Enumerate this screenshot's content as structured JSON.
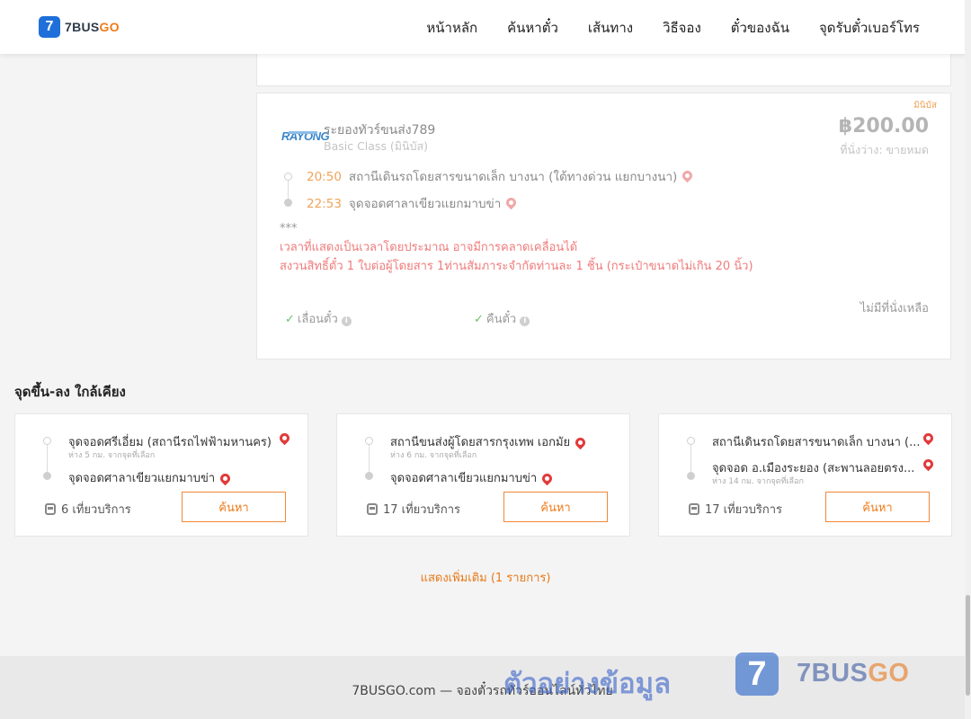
{
  "header": {
    "logo_mark": "7",
    "logo_text_main": "7BUS",
    "logo_text_accent": "GO",
    "nav": [
      "หน้าหลัก",
      "ค้นหาตั๋ว",
      "เส้นทาง",
      "วิธีจอง",
      "ตั๋วของฉัน",
      "จุดรับตั๋วเบอร์โทร"
    ]
  },
  "trip": {
    "badge": "มินิบัส",
    "operator_logo": "RAYONG",
    "operator_name": "ระยองทัวร์ขนส่ง789",
    "bus_class": "Basic Class (มินิบัส)",
    "price": "฿200.00",
    "seats_status": "ที่นั่งว่าง: ขายหมด",
    "departure": {
      "time": "20:50",
      "place": "สถานีเดินรถโดยสารขนาดเล็ก บางนา (ใต้ทางด่วน แยกบางนา)"
    },
    "arrival": {
      "time": "22:53",
      "place": "จุดจอดศาลาเขียวแยกมาบข่า"
    },
    "note_marker": "***",
    "note_lines": [
      "เวลาที่แสดงเป็นเวลาโดยประมาณ อาจมีการคลาดเคลื่อนได้",
      "สงวนสิทธิ์ตั๋ว 1 ใบต่อผู้โดยสาร 1ท่านสัมภาระจำกัดท่านละ 1 ชิ้น (กระเป๋าขนาดไม่เกิน 20 นิ้ว)"
    ],
    "features": [
      "เลื่อนตั๋ว",
      "คืนตั๋ว"
    ],
    "no_seat_text": "ไม่มีที่นั่งเหลือ"
  },
  "nearby": {
    "title": "จุดขึ้น-ลง ใกล้เคียง",
    "cards": [
      {
        "from": "จุดจอดศรีเอี่ยม (สถานีรถไฟฟ้ามหานคร)",
        "from_dist": "ห่าง 5 กม. จากจุดที่เลือก",
        "to": "จุดจอดศาลาเขียวแยกมาบข่า",
        "to_dist": "",
        "trips": "6 เที่ยวบริการ",
        "button": "ค้นหา"
      },
      {
        "from": "สถานีขนส่งผู้โดยสารกรุงเทพ เอกมัย",
        "from_dist": "ห่าง 6 กม. จากจุดที่เลือก",
        "to": "จุดจอดศาลาเขียวแยกมาบข่า",
        "to_dist": "",
        "trips": "17 เที่ยวบริการ",
        "button": "ค้นหา"
      },
      {
        "from": "สถานีเดินรถโดยสารขนาดเล็ก บางนา (...",
        "from_dist": "",
        "to": "จุดจอด อ.เมืองระยอง (สะพานลอยตรง...",
        "to_dist": "ห่าง 14 กม. จากจุดที่เลือก",
        "trips": "17 เที่ยวบริการ",
        "button": "ค้นหา"
      }
    ],
    "show_more": "แสดงเพิ่มเติม (1 รายการ)"
  },
  "footer": {
    "text": "7BUSGO.com — จองตั๋วรถทัวร์ออนไลน์ทั่วไทย",
    "watermark_text": "ตัวอย่างข้อมูล",
    "watermark_logo": "7",
    "watermark_brand_main": "7BUS",
    "watermark_brand_accent": "GO"
  },
  "colors": {
    "accent": "#f07b1a",
    "brand_blue": "#1e6fd9",
    "note_red": "#f07b7b",
    "pin_red": "#e23a3a"
  }
}
